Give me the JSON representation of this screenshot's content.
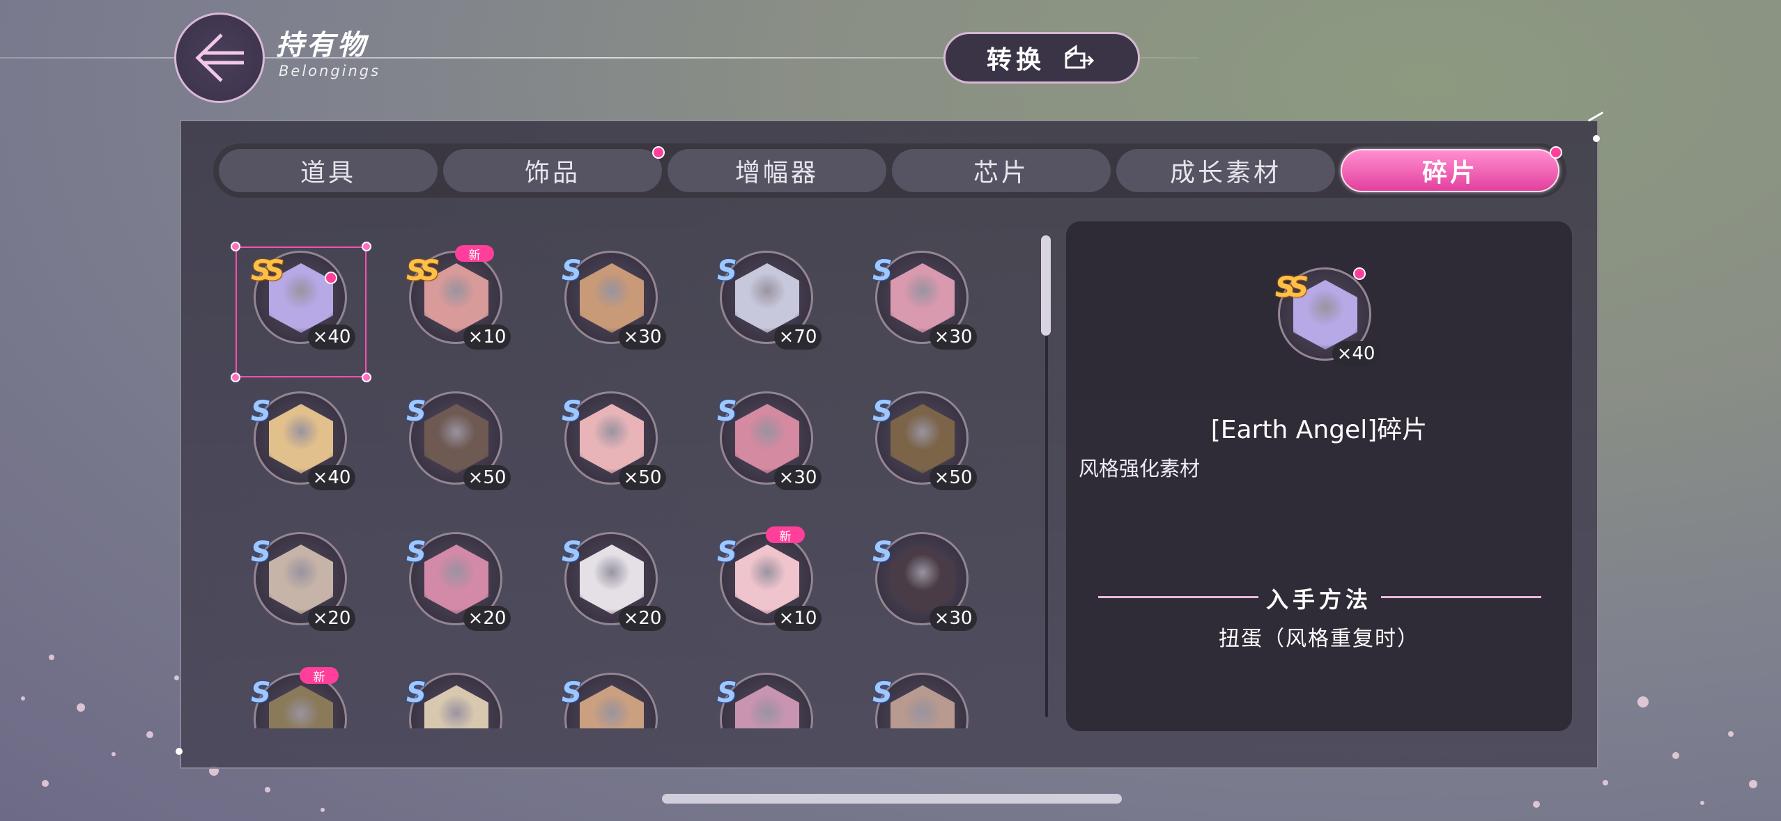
{
  "header": {
    "title_cn": "持有物",
    "title_en": "Belongings",
    "convert_label": "转换"
  },
  "tabs": [
    {
      "label": "道具",
      "active": false,
      "badge": false
    },
    {
      "label": "饰品",
      "active": false,
      "badge": true
    },
    {
      "label": "增幅器",
      "active": false,
      "badge": false
    },
    {
      "label": "芯片",
      "active": false,
      "badge": false
    },
    {
      "label": "成长素材",
      "active": false,
      "badge": false
    },
    {
      "label": "碎片",
      "active": true,
      "badge": true
    }
  ],
  "items": [
    {
      "rank": "SS",
      "count": "×40",
      "new": false,
      "badge": true,
      "selected": true,
      "color": "#b7a8e6"
    },
    {
      "rank": "SS",
      "count": "×10",
      "new": true,
      "new_label": "新",
      "badge": false,
      "color": "#d99a9a"
    },
    {
      "rank": "S",
      "count": "×30",
      "new": false,
      "badge": false,
      "color": "#c99a78"
    },
    {
      "rank": "S",
      "count": "×70",
      "new": false,
      "badge": false,
      "color": "#c8c8dc"
    },
    {
      "rank": "S",
      "count": "×30",
      "new": false,
      "badge": false,
      "color": "#d999ae"
    },
    {
      "rank": "S",
      "count": "×40",
      "new": false,
      "badge": false,
      "color": "#e2c08c"
    },
    {
      "rank": "S",
      "count": "×50",
      "new": false,
      "badge": false,
      "color": "#6e5a52"
    },
    {
      "rank": "S",
      "count": "×50",
      "new": false,
      "badge": false,
      "color": "#e8b4b8"
    },
    {
      "rank": "S",
      "count": "×30",
      "new": false,
      "badge": false,
      "color": "#d48aa0"
    },
    {
      "rank": "S",
      "count": "×50",
      "new": false,
      "badge": false,
      "color": "#7b6448"
    },
    {
      "rank": "S",
      "count": "×20",
      "new": false,
      "badge": false,
      "color": "#c7b4a8"
    },
    {
      "rank": "S",
      "count": "×20",
      "new": false,
      "badge": false,
      "color": "#d28aa8"
    },
    {
      "rank": "S",
      "count": "×20",
      "new": false,
      "badge": false,
      "color": "#e4e0e6"
    },
    {
      "rank": "S",
      "count": "×10",
      "new": true,
      "new_label": "新",
      "badge": false,
      "color": "#f0c4cc"
    },
    {
      "rank": "S",
      "count": "×30",
      "new": false,
      "badge": false,
      "color": "#4a3c46"
    },
    {
      "rank": "S",
      "count": "",
      "new": true,
      "new_label": "新",
      "badge": false,
      "color": "#8a7a5a"
    },
    {
      "rank": "S",
      "count": "",
      "new": false,
      "badge": false,
      "color": "#d8c8b0"
    },
    {
      "rank": "S",
      "count": "",
      "new": false,
      "badge": false,
      "color": "#caa080"
    },
    {
      "rank": "S",
      "count": "",
      "new": false,
      "badge": false,
      "color": "#c894b0"
    },
    {
      "rank": "S",
      "count": "",
      "new": false,
      "badge": false,
      "color": "#b89a90"
    }
  ],
  "detail": {
    "rank": "SS",
    "count": "×40",
    "name": "[Earth Angel]碎片",
    "type": "风格强化素材",
    "obtain_title": "入手方法",
    "obtain_text": "扭蛋（风格重复时）"
  },
  "colors": {
    "accent": "#ff3f9a",
    "tab_active": "#e3409e",
    "panel": "#3c3a48"
  }
}
